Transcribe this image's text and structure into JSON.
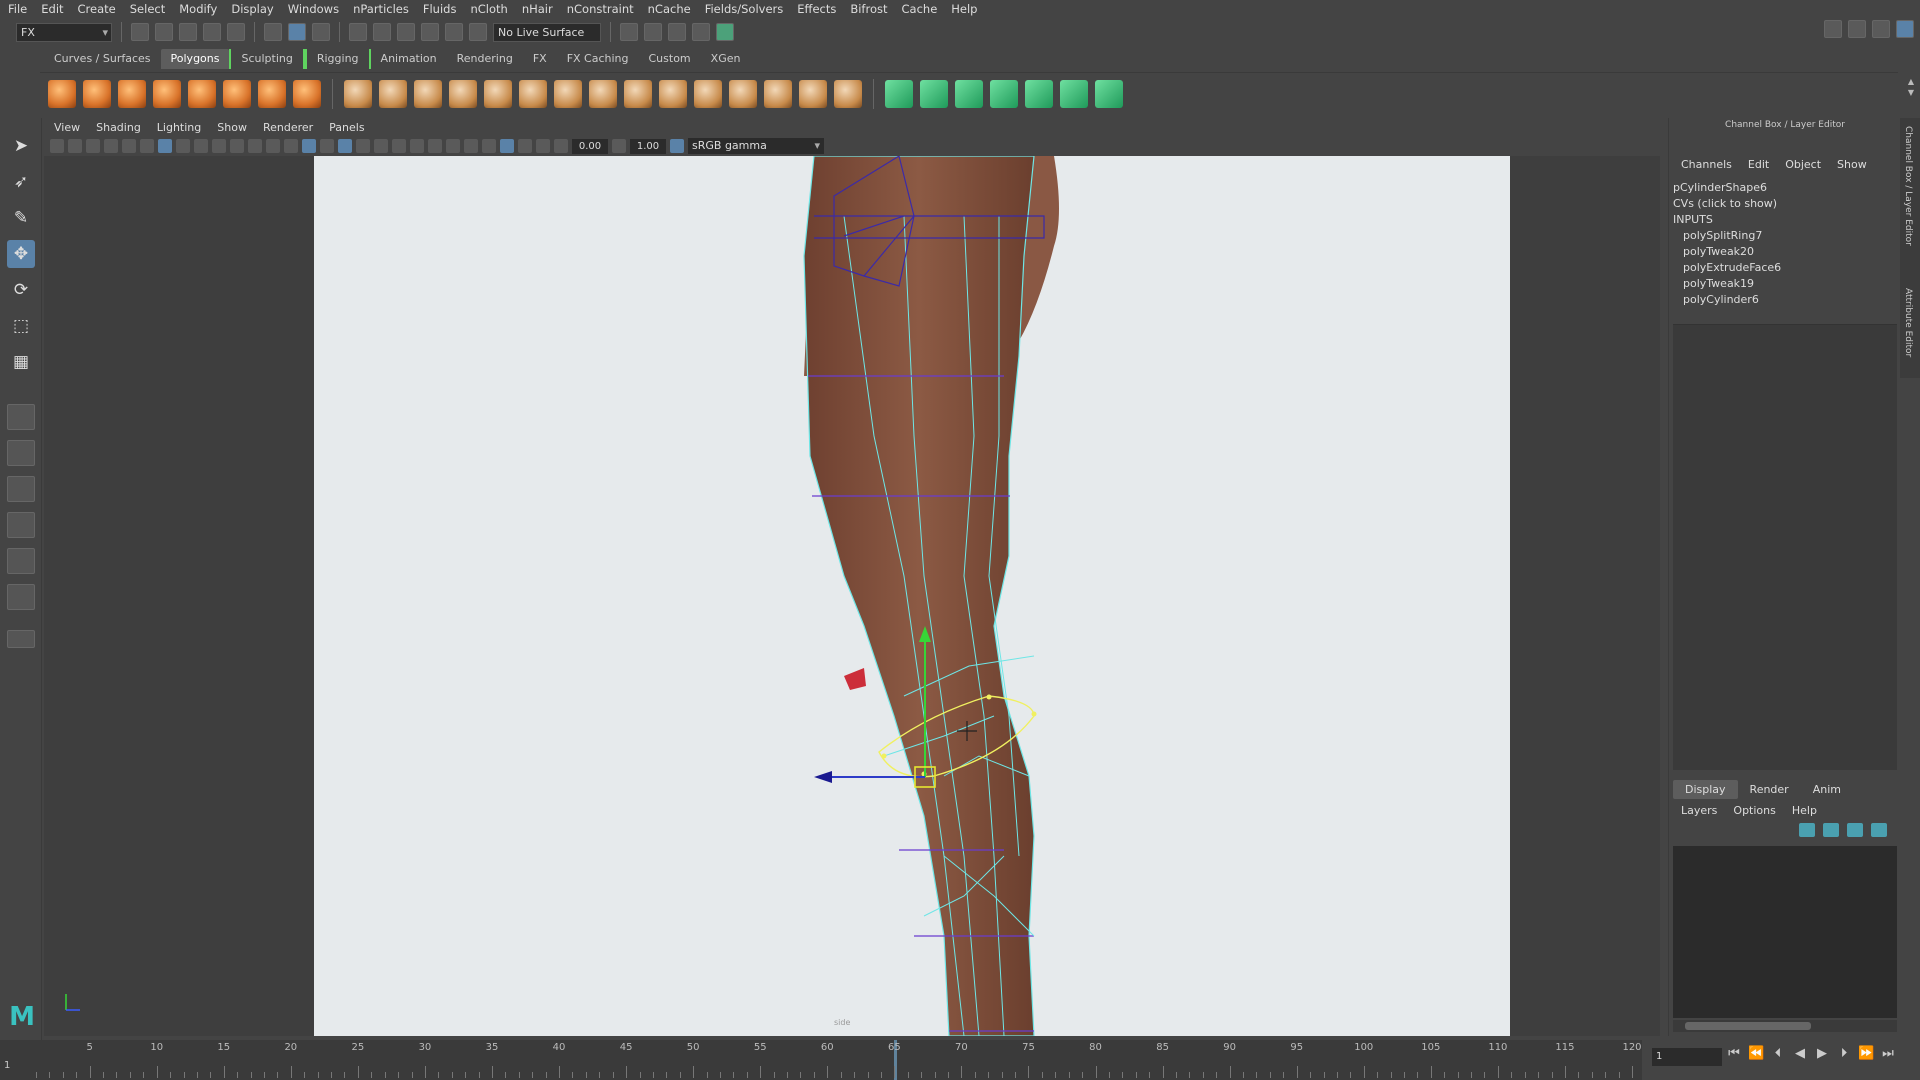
{
  "menubar": {
    "items": [
      "File",
      "Edit",
      "Create",
      "Select",
      "Modify",
      "Display",
      "Windows",
      "nParticles",
      "Fluids",
      "nCloth",
      "nHair",
      "nConstraint",
      "nCache",
      "Fields/Solvers",
      "Effects",
      "Bifrost",
      "Cache",
      "Help"
    ]
  },
  "statusline": {
    "mode": "FX",
    "live_surface": "No Live Surface"
  },
  "shelf": {
    "tabs": [
      "Curves / Surfaces",
      "Polygons",
      "Sculpting",
      "Rigging",
      "Animation",
      "Rendering",
      "FX",
      "FX Caching",
      "Custom",
      "XGen"
    ],
    "active_tab": "Polygons"
  },
  "panel": {
    "menu": [
      "View",
      "Shading",
      "Lighting",
      "Show",
      "Renderer",
      "Panels"
    ],
    "exposure": "0.00",
    "gamma": "1.00",
    "color_space": "sRGB gamma",
    "camera": "side"
  },
  "channel_box": {
    "title": "Channel Box / Layer Editor",
    "menu": [
      "Channels",
      "Edit",
      "Object",
      "Show"
    ],
    "shape": "pCylinderShape6",
    "cvs": "CVs (click to show)",
    "inputs_label": "INPUTS",
    "inputs": [
      "polySplitRing7",
      "polyTweak20",
      "polyExtrudeFace6",
      "polyTweak19",
      "polyCylinder6"
    ]
  },
  "layer_editor": {
    "tabs": [
      "Display",
      "Render",
      "Anim"
    ],
    "active_tab": "Display",
    "menu": [
      "Layers",
      "Options",
      "Help"
    ]
  },
  "side_tabs": [
    "Channel Box / Layer Editor",
    "Attribute Editor"
  ],
  "timeline": {
    "ticks": [
      "5",
      "10",
      "15",
      "20",
      "25",
      "30",
      "35",
      "40",
      "45",
      "50",
      "55",
      "60",
      "65",
      "70",
      "75",
      "80",
      "85",
      "90",
      "95",
      "100",
      "105",
      "110",
      "115",
      "120"
    ],
    "start": "1",
    "current": "1",
    "range_start": "1",
    "current_frame": 65
  },
  "colors": {
    "accent": "#5a82a8",
    "skin": "#8c5a44",
    "wire_cyan": "#6ee6e6",
    "wire_purple": "#6a3ccf",
    "background": "#e6eaec"
  }
}
